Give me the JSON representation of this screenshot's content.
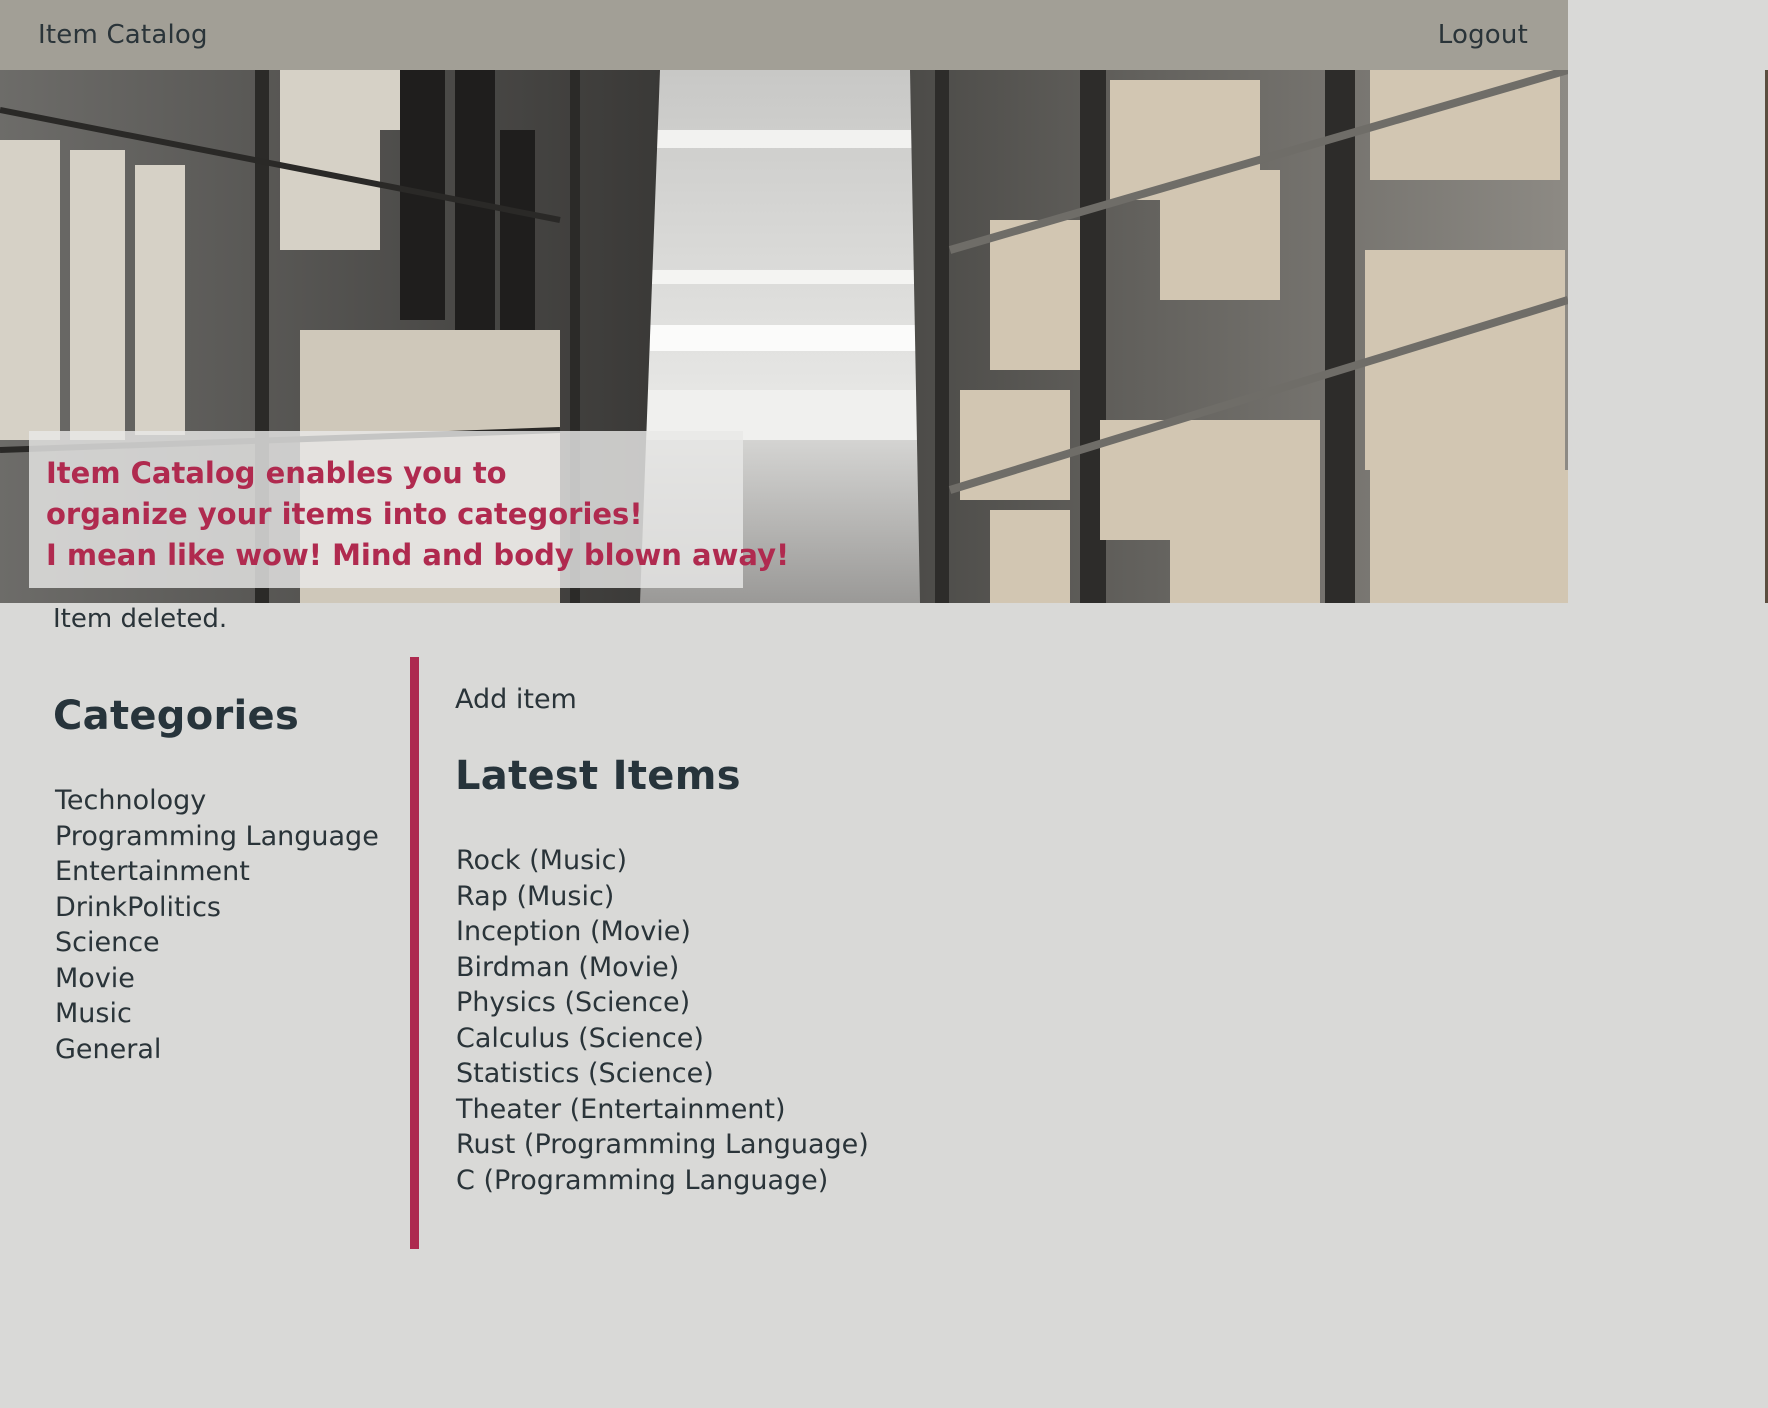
{
  "navbar": {
    "brand": "Item Catalog",
    "logout": "Logout"
  },
  "hero": {
    "image": "warehouse-shelves-photo",
    "lines": [
      "Item Catalog enables you to",
      "organize your items into categories!",
      "I mean like wow! Mind and body blown away!"
    ]
  },
  "flash": "Item deleted.",
  "sidebar": {
    "title": "Categories",
    "categories": [
      "Technology",
      "Programming Language",
      "Entertainment",
      "DrinkPolitics",
      "Science",
      "Movie",
      "Music",
      "General"
    ]
  },
  "main": {
    "add_item": "Add item",
    "title": "Latest Items",
    "items": [
      {
        "name": "Rock",
        "category": "Music"
      },
      {
        "name": "Rap",
        "category": "Music"
      },
      {
        "name": "Inception",
        "category": "Movie"
      },
      {
        "name": "Birdman",
        "category": "Movie"
      },
      {
        "name": "Physics",
        "category": "Science"
      },
      {
        "name": "Calculus",
        "category": "Science"
      },
      {
        "name": "Statistics",
        "category": "Science"
      },
      {
        "name": "Theater",
        "category": "Entertainment"
      },
      {
        "name": "Rust",
        "category": "Programming Language"
      },
      {
        "name": "C",
        "category": "Programming Language"
      }
    ]
  },
  "colors": {
    "navbar": "#a29f96",
    "background": "#d9d9d7",
    "accent": "#ad2a4f",
    "text": "#27343b"
  }
}
